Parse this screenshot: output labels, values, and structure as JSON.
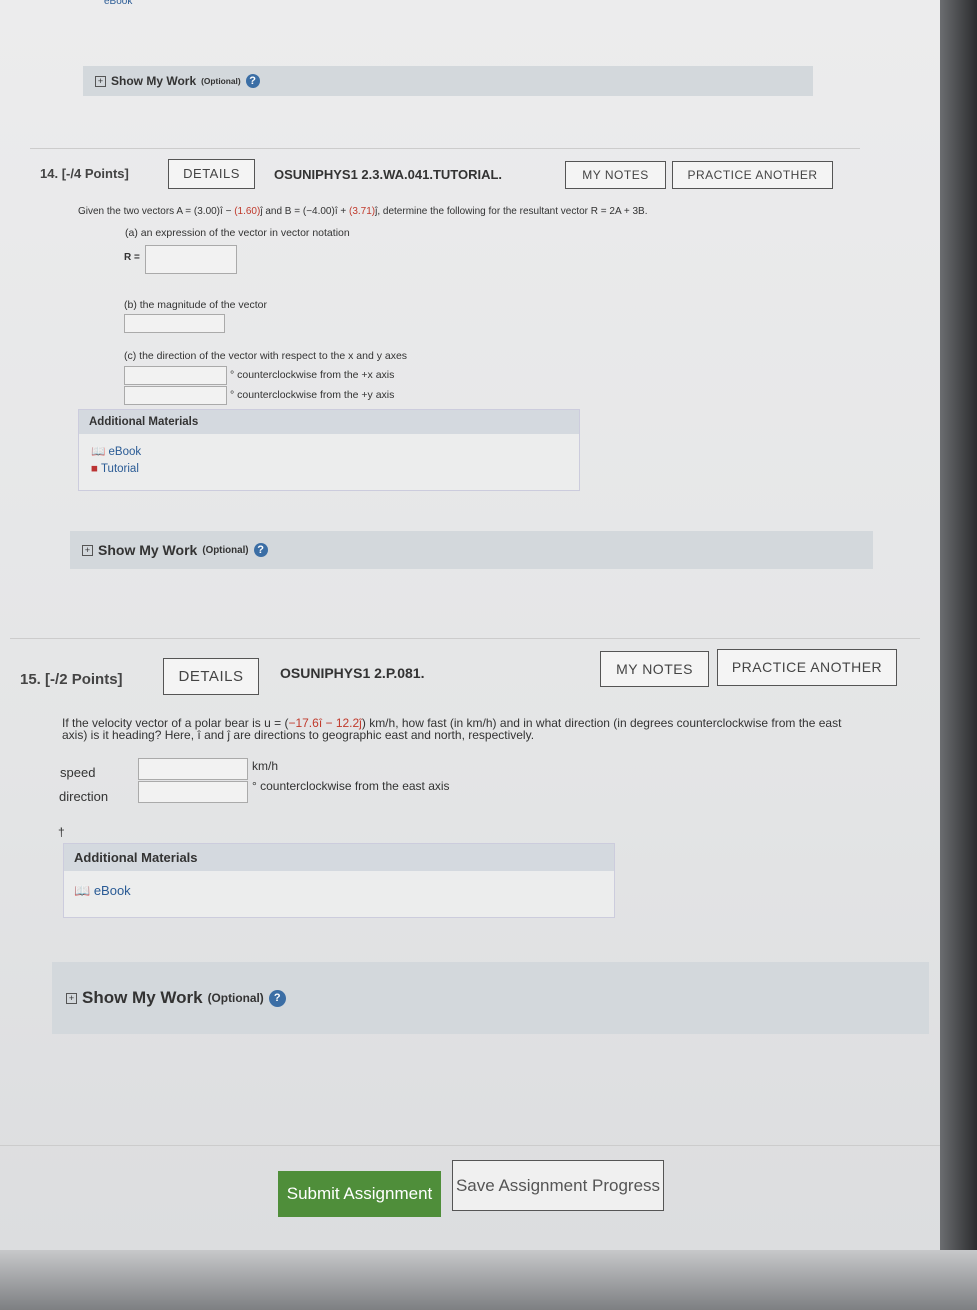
{
  "top_ebook": "eBook",
  "show_my_work": {
    "label": "Show My Work",
    "optional": "(Optional)",
    "help": "?"
  },
  "q14": {
    "number": "14.",
    "points": "[-/4 Points]",
    "details": "DETAILS",
    "code": "OSUNIPHYS1 2.3.WA.041.TUTORIAL.",
    "my_notes": "MY NOTES",
    "practice": "PRACTICE ANOTHER",
    "prompt_a": "Given the two vectors A = (3.00)î − ",
    "prompt_a1": "(1.60)",
    "prompt_a2": "ĵ and B = (−4.00)î + ",
    "prompt_a3": "(3.71)",
    "prompt_a4": "ĵ, determine the following for the resultant vector R = 2A + 3B.",
    "part_a": "(a) an expression of the vector in vector notation",
    "r_label": "R =",
    "part_b": "(b) the magnitude of the vector",
    "part_c": "(c) the direction of the vector with respect to the x and y axes",
    "ccw_x": "° counterclockwise from the +x axis",
    "ccw_y": "° counterclockwise from the +y axis",
    "additional": "Additional Materials",
    "ebook": "eBook",
    "tutorial": "Tutorial"
  },
  "q15": {
    "number": "15.",
    "points": "[-/2 Points]",
    "details": "DETAILS",
    "code": "OSUNIPHYS1 2.P.081.",
    "my_notes": "MY NOTES",
    "practice": "PRACTICE ANOTHER",
    "prompt1": "If the velocity vector of a polar bear is u = (",
    "prompt1r": "−17.6î − 12.2ĵ",
    "prompt1b": ") km/h, how fast (in km/h) and in what direction (in degrees counterclockwise from the east",
    "prompt2": "axis) is it heading? Here, î and ĵ are directions to geographic east and north, respectively.",
    "speed": "speed",
    "speed_unit": "km/h",
    "direction": "direction",
    "direction_unit": "° counterclockwise from the east axis",
    "dagger": "†",
    "additional": "Additional Materials",
    "ebook": "eBook"
  },
  "footer": {
    "submit": "Submit Assignment",
    "save": "Save Assignment Progress"
  }
}
